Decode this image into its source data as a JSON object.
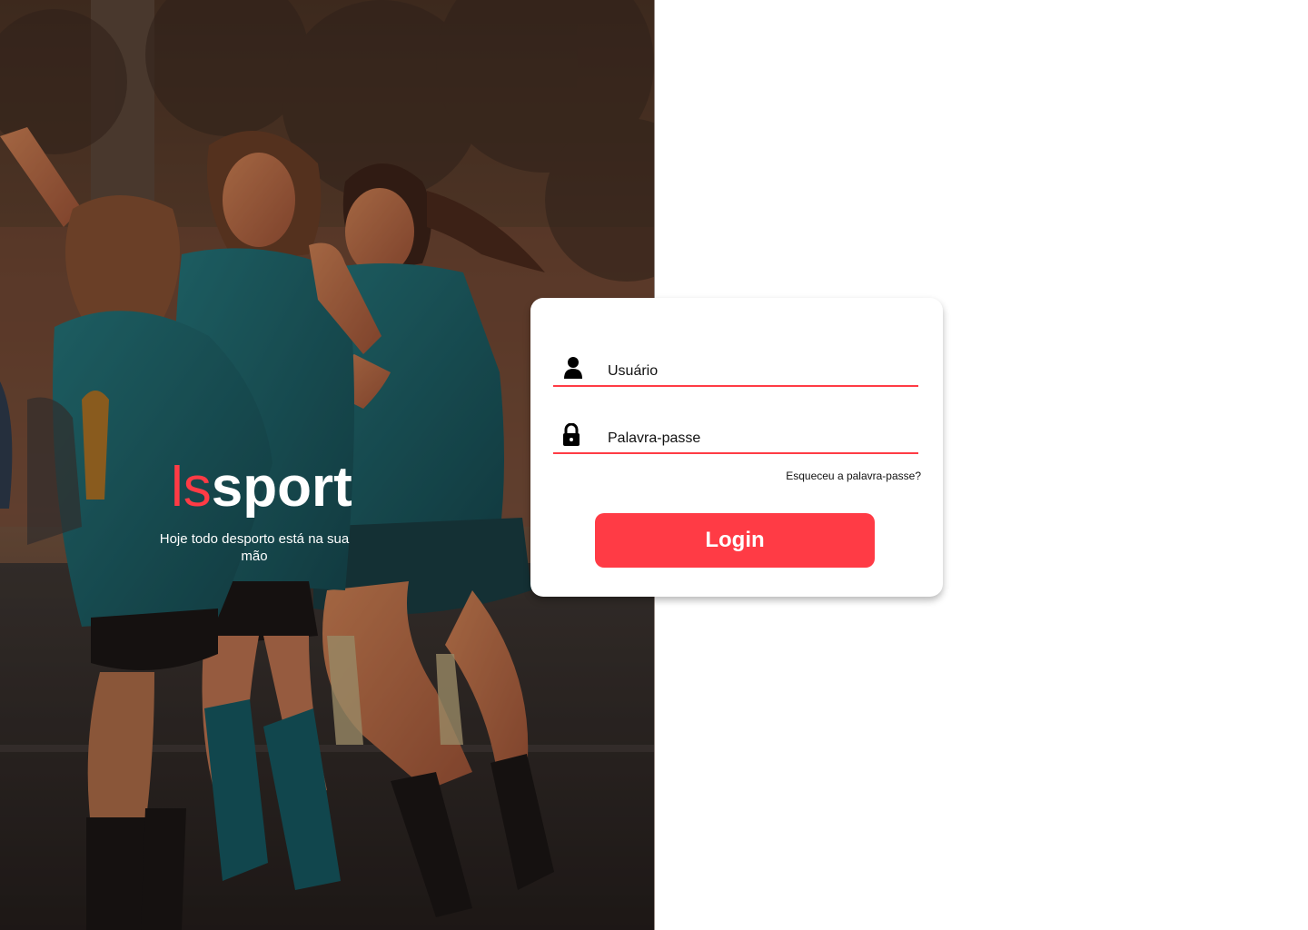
{
  "hero": {
    "brand_prefix": "ls",
    "brand_name": "sport",
    "tagline": "Hoje todo desporto está na sua mão",
    "photo_alt": "hero-photo"
  },
  "login": {
    "username_placeholder": "Usuário",
    "password_placeholder": "Palavra-passe",
    "forgot_label": "Esqueceu a palavra-passe?",
    "submit_label": "Login"
  },
  "colors": {
    "accent": "#ff3b45",
    "background": "#ffffff",
    "text": "#111111"
  },
  "icons": {
    "username": "user-icon",
    "password": "lock-icon"
  }
}
